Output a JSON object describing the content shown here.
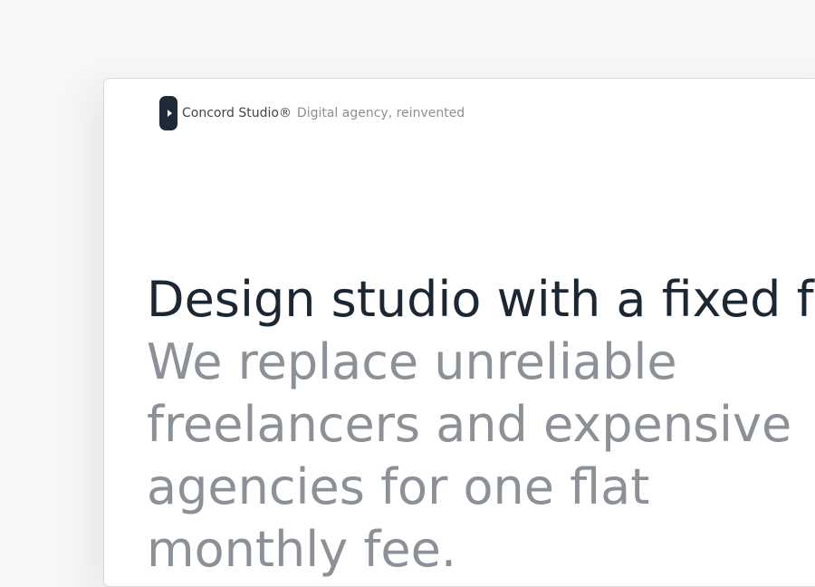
{
  "header": {
    "brand_name": "Concord Studio®",
    "tagline": "Digital agency, reinvented",
    "logo_icon": "play-arrow-icon"
  },
  "hero": {
    "title": "Design studio with a fixed fee",
    "subtitle": "We replace unreliable freelancers and expensive agencies for one flat monthly fee."
  },
  "colors": {
    "background": "#f7f7f7",
    "card": "#ffffff",
    "title": "#1b2733",
    "subtitle": "#8b9197",
    "logo": "#1e2a36"
  }
}
